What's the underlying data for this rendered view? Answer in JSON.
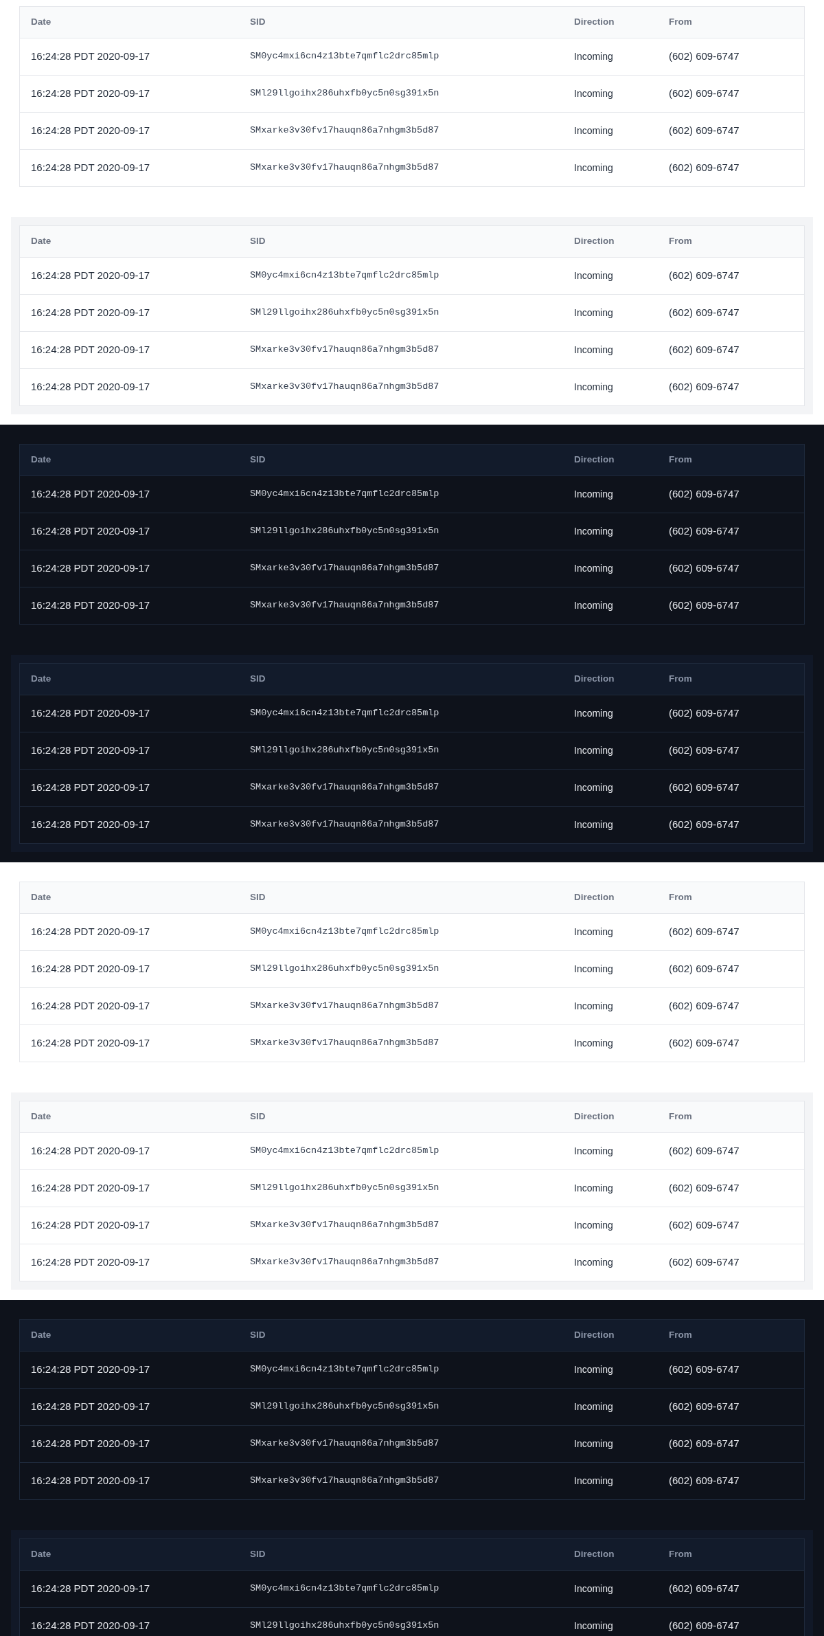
{
  "sections": [
    {
      "kind": "light",
      "tables": [
        {
          "wrapped": false,
          "columns": [
            "Date",
            "SID",
            "Direction",
            "From"
          ],
          "rows": [
            {
              "date": "16:24:28 PDT 2020-09-17",
              "sid": "SM0yc4mxi6cn4z13bte7qmflc2drc85mlp",
              "direction": "Incoming",
              "from": "(602) 609-6747"
            },
            {
              "date": "16:24:28 PDT 2020-09-17",
              "sid": "SMl29llgoihx286uhxfb0yc5n0sg391x5n",
              "direction": "Incoming",
              "from": "(602) 609-6747"
            },
            {
              "date": "16:24:28 PDT 2020-09-17",
              "sid": "SMxarke3v30fv17hauqn86a7nhgm3b5d87",
              "direction": "Incoming",
              "from": "(602) 609-6747"
            },
            {
              "date": "16:24:28 PDT 2020-09-17",
              "sid": "SMxarke3v30fv17hauqn86a7nhgm3b5d87",
              "direction": "Incoming",
              "from": "(602) 609-6747"
            }
          ]
        },
        {
          "wrapped": true,
          "columns": [
            "Date",
            "SID",
            "Direction",
            "From"
          ],
          "rows": [
            {
              "date": "16:24:28 PDT 2020-09-17",
              "sid": "SM0yc4mxi6cn4z13bte7qmflc2drc85mlp",
              "direction": "Incoming",
              "from": "(602) 609-6747"
            },
            {
              "date": "16:24:28 PDT 2020-09-17",
              "sid": "SMl29llgoihx286uhxfb0yc5n0sg391x5n",
              "direction": "Incoming",
              "from": "(602) 609-6747"
            },
            {
              "date": "16:24:28 PDT 2020-09-17",
              "sid": "SMxarke3v30fv17hauqn86a7nhgm3b5d87",
              "direction": "Incoming",
              "from": "(602) 609-6747"
            },
            {
              "date": "16:24:28 PDT 2020-09-17",
              "sid": "SMxarke3v30fv17hauqn86a7nhgm3b5d87",
              "direction": "Incoming",
              "from": "(602) 609-6747"
            }
          ]
        }
      ]
    },
    {
      "kind": "dark",
      "tables": [
        {
          "wrapped": false,
          "columns": [
            "Date",
            "SID",
            "Direction",
            "From"
          ],
          "rows": [
            {
              "date": "16:24:28 PDT 2020-09-17",
              "sid": "SM0yc4mxi6cn4z13bte7qmflc2drc85mlp",
              "direction": "Incoming",
              "from": "(602) 609-6747"
            },
            {
              "date": "16:24:28 PDT 2020-09-17",
              "sid": "SMl29llgoihx286uhxfb0yc5n0sg391x5n",
              "direction": "Incoming",
              "from": "(602) 609-6747"
            },
            {
              "date": "16:24:28 PDT 2020-09-17",
              "sid": "SMxarke3v30fv17hauqn86a7nhgm3b5d87",
              "direction": "Incoming",
              "from": "(602) 609-6747"
            },
            {
              "date": "16:24:28 PDT 2020-09-17",
              "sid": "SMxarke3v30fv17hauqn86a7nhgm3b5d87",
              "direction": "Incoming",
              "from": "(602) 609-6747"
            }
          ]
        },
        {
          "wrapped": true,
          "columns": [
            "Date",
            "SID",
            "Direction",
            "From"
          ],
          "rows": [
            {
              "date": "16:24:28 PDT 2020-09-17",
              "sid": "SM0yc4mxi6cn4z13bte7qmflc2drc85mlp",
              "direction": "Incoming",
              "from": "(602) 609-6747"
            },
            {
              "date": "16:24:28 PDT 2020-09-17",
              "sid": "SMl29llgoihx286uhxfb0yc5n0sg391x5n",
              "direction": "Incoming",
              "from": "(602) 609-6747"
            },
            {
              "date": "16:24:28 PDT 2020-09-17",
              "sid": "SMxarke3v30fv17hauqn86a7nhgm3b5d87",
              "direction": "Incoming",
              "from": "(602) 609-6747"
            },
            {
              "date": "16:24:28 PDT 2020-09-17",
              "sid": "SMxarke3v30fv17hauqn86a7nhgm3b5d87",
              "direction": "Incoming",
              "from": "(602) 609-6747"
            }
          ]
        }
      ]
    },
    {
      "kind": "light",
      "tables": [
        {
          "wrapped": false,
          "columns": [
            "Date",
            "SID",
            "Direction",
            "From"
          ],
          "rows": [
            {
              "date": "16:24:28 PDT 2020-09-17",
              "sid": "SM0yc4mxi6cn4z13bte7qmflc2drc85mlp",
              "direction": "Incoming",
              "from": "(602) 609-6747"
            },
            {
              "date": "16:24:28 PDT 2020-09-17",
              "sid": "SMl29llgoihx286uhxfb0yc5n0sg391x5n",
              "direction": "Incoming",
              "from": "(602) 609-6747"
            },
            {
              "date": "16:24:28 PDT 2020-09-17",
              "sid": "SMxarke3v30fv17hauqn86a7nhgm3b5d87",
              "direction": "Incoming",
              "from": "(602) 609-6747"
            },
            {
              "date": "16:24:28 PDT 2020-09-17",
              "sid": "SMxarke3v30fv17hauqn86a7nhgm3b5d87",
              "direction": "Incoming",
              "from": "(602) 609-6747"
            }
          ]
        },
        {
          "wrapped": true,
          "columns": [
            "Date",
            "SID",
            "Direction",
            "From"
          ],
          "rows": [
            {
              "date": "16:24:28 PDT 2020-09-17",
              "sid": "SM0yc4mxi6cn4z13bte7qmflc2drc85mlp",
              "direction": "Incoming",
              "from": "(602) 609-6747"
            },
            {
              "date": "16:24:28 PDT 2020-09-17",
              "sid": "SMl29llgoihx286uhxfb0yc5n0sg391x5n",
              "direction": "Incoming",
              "from": "(602) 609-6747"
            },
            {
              "date": "16:24:28 PDT 2020-09-17",
              "sid": "SMxarke3v30fv17hauqn86a7nhgm3b5d87",
              "direction": "Incoming",
              "from": "(602) 609-6747"
            },
            {
              "date": "16:24:28 PDT 2020-09-17",
              "sid": "SMxarke3v30fv17hauqn86a7nhgm3b5d87",
              "direction": "Incoming",
              "from": "(602) 609-6747"
            }
          ]
        }
      ]
    },
    {
      "kind": "dark",
      "tables": [
        {
          "wrapped": false,
          "columns": [
            "Date",
            "SID",
            "Direction",
            "From"
          ],
          "rows": [
            {
              "date": "16:24:28 PDT 2020-09-17",
              "sid": "SM0yc4mxi6cn4z13bte7qmflc2drc85mlp",
              "direction": "Incoming",
              "from": "(602) 609-6747"
            },
            {
              "date": "16:24:28 PDT 2020-09-17",
              "sid": "SMl29llgoihx286uhxfb0yc5n0sg391x5n",
              "direction": "Incoming",
              "from": "(602) 609-6747"
            },
            {
              "date": "16:24:28 PDT 2020-09-17",
              "sid": "SMxarke3v30fv17hauqn86a7nhgm3b5d87",
              "direction": "Incoming",
              "from": "(602) 609-6747"
            },
            {
              "date": "16:24:28 PDT 2020-09-17",
              "sid": "SMxarke3v30fv17hauqn86a7nhgm3b5d87",
              "direction": "Incoming",
              "from": "(602) 609-6747"
            }
          ]
        },
        {
          "wrapped": true,
          "columns": [
            "Date",
            "SID",
            "Direction",
            "From"
          ],
          "rows": [
            {
              "date": "16:24:28 PDT 2020-09-17",
              "sid": "SM0yc4mxi6cn4z13bte7qmflc2drc85mlp",
              "direction": "Incoming",
              "from": "(602) 609-6747"
            },
            {
              "date": "16:24:28 PDT 2020-09-17",
              "sid": "SMl29llgoihx286uhxfb0yc5n0sg391x5n",
              "direction": "Incoming",
              "from": "(602) 609-6747"
            }
          ]
        }
      ]
    }
  ]
}
